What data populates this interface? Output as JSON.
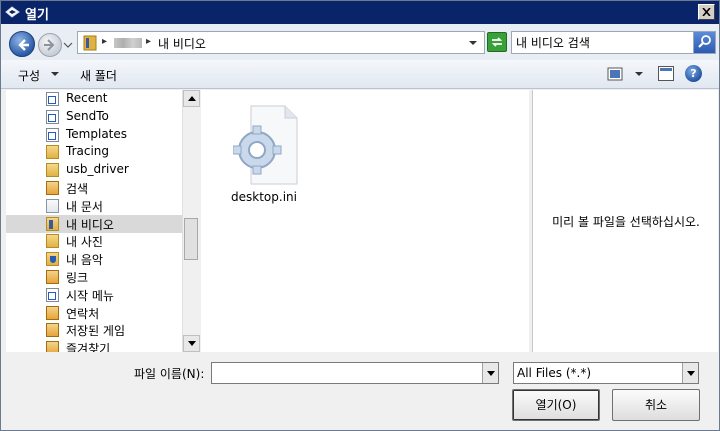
{
  "window": {
    "title": "열기",
    "close_label": "×"
  },
  "address": {
    "crumb_separator": "▸",
    "crumb_current": "내 비디오"
  },
  "search": {
    "value": "내 비디오 검색"
  },
  "toolbar": {
    "organize_label": "구성",
    "new_folder_label": "새 폴더"
  },
  "tree": {
    "items": [
      {
        "label": "Recent",
        "icon": "recent-shortcut-icon"
      },
      {
        "label": "SendTo",
        "icon": "sendto-shortcut-icon"
      },
      {
        "label": "Templates",
        "icon": "templates-shortcut-icon"
      },
      {
        "label": "Tracing",
        "icon": "folder-icon"
      },
      {
        "label": "usb_driver",
        "icon": "folder-icon"
      },
      {
        "label": "검색",
        "icon": "search-folder-icon"
      },
      {
        "label": "내 문서",
        "icon": "documents-folder-icon"
      },
      {
        "label": "내 비디오",
        "icon": "videos-folder-icon",
        "selected": true
      },
      {
        "label": "내 사진",
        "icon": "pictures-folder-icon"
      },
      {
        "label": "내 음악",
        "icon": "music-folder-icon"
      },
      {
        "label": "링크",
        "icon": "links-folder-icon"
      },
      {
        "label": "시작 메뉴",
        "icon": "start-menu-shortcut-icon"
      },
      {
        "label": "연락처",
        "icon": "contacts-folder-icon"
      },
      {
        "label": "저장된 게임",
        "icon": "saved-games-folder-icon"
      },
      {
        "label": "즐겨찾기",
        "icon": "favorites-folder-icon"
      }
    ]
  },
  "files": {
    "items": [
      {
        "name": "desktop.ini",
        "icon": "settings-file-icon"
      }
    ]
  },
  "preview": {
    "message": "미리 볼 파일을 선택하십시오."
  },
  "footer": {
    "filename_label": "파일 이름(N):",
    "filename_value": "",
    "filter_value": "All Files (*.*)",
    "open_label": "열기(O)",
    "cancel_label": "취소"
  },
  "colors": {
    "titlebar": "#0a246a",
    "selection": "#d9d9d9"
  }
}
